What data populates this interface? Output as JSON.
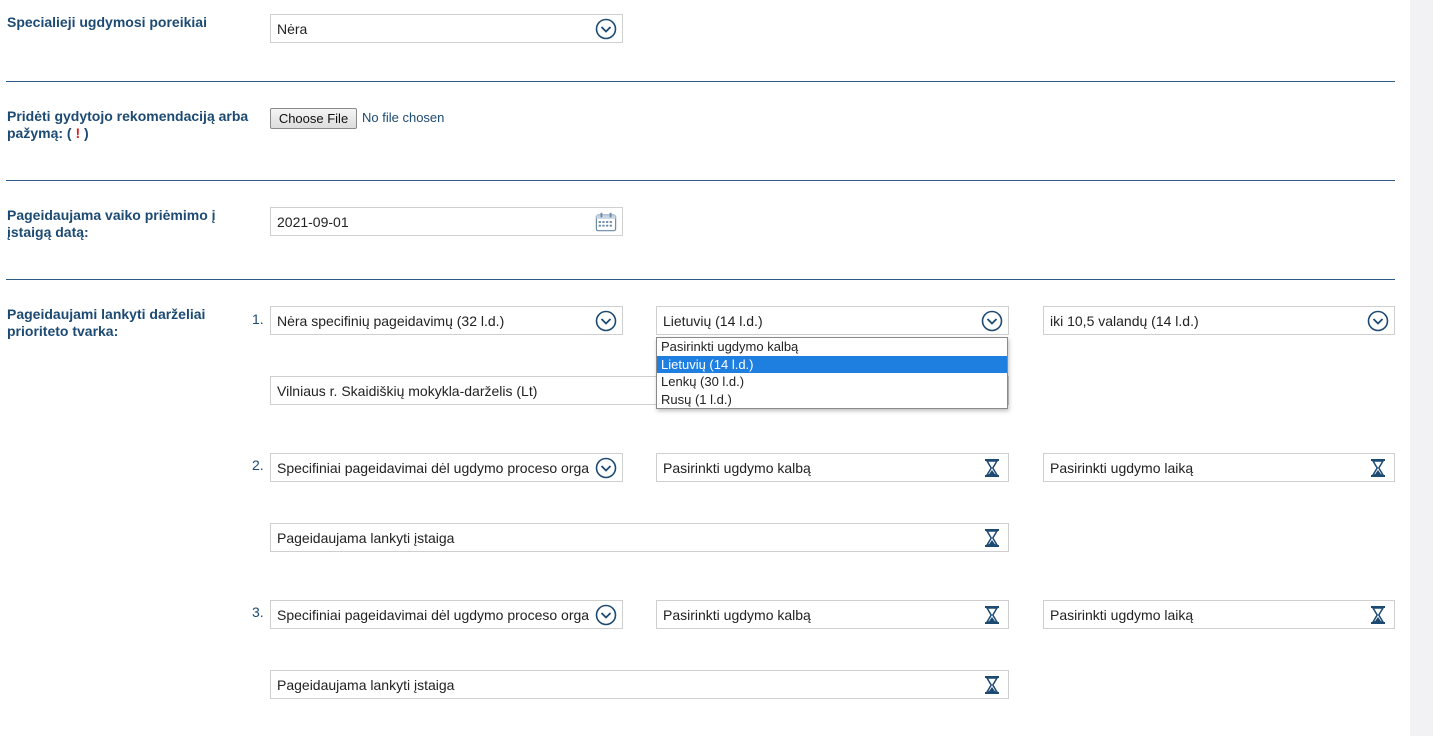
{
  "colors": {
    "label": "#1c4a73",
    "divider": "#2b5b86",
    "icon": "#1c4a73",
    "selected_option": "#1e7fe0",
    "required_mark": "#d32020"
  },
  "special_needs": {
    "label": "Specialieji ugdymosi poreikiai",
    "value": "Nėra",
    "icon": "chevron-circle-down-icon"
  },
  "attachment": {
    "label": "Pridėti gydytojo rekomendaciją arba pažymą:",
    "label_open": "(",
    "required_mark": "!",
    "label_close": ")",
    "button_label": "Choose File",
    "status": "No file chosen"
  },
  "admission_date": {
    "label": "Pageidaujama vaiko priėmimo į įstaigą datą:",
    "value": "2021-09-01",
    "icon": "calendar-icon"
  },
  "kindergartens": {
    "label": "Pageidaujami lankyti darželiai prioriteto tvarka:",
    "entries": [
      {
        "number": "1.",
        "specifics": "Nėra specifinių pageidavimų (32 l.d.)",
        "language": "Lietuvių (14 l.d.)",
        "time": "iki 10,5 valandų (14 l.d.)",
        "institution": "Vilniaus r. Skaidiškių mokykla-darželis (Lt)"
      },
      {
        "number": "2.",
        "specifics": "Specifiniai pageidavimai dėl ugdymo proceso orga",
        "language": "Pasirinkti ugdymo kalbą",
        "time": "Pasirinkti ugdymo laiką",
        "institution": "Pageidaujama lankyti įstaiga"
      },
      {
        "number": "3.",
        "specifics": "Specifiniai pageidavimai dėl ugdymo proceso orga",
        "language": "Pasirinkti ugdymo kalbą",
        "time": "Pasirinkti ugdymo laiką",
        "institution": "Pageidaujama lankyti įstaiga"
      }
    ],
    "language_dropdown": {
      "options": [
        "Pasirinkti ugdymo kalbą",
        "Lietuvių (14 l.d.)",
        "Lenkų (30 l.d.)",
        "Rusų (1 l.d.)"
      ],
      "highlighted": "Lietuvių (14 l.d.)"
    }
  }
}
